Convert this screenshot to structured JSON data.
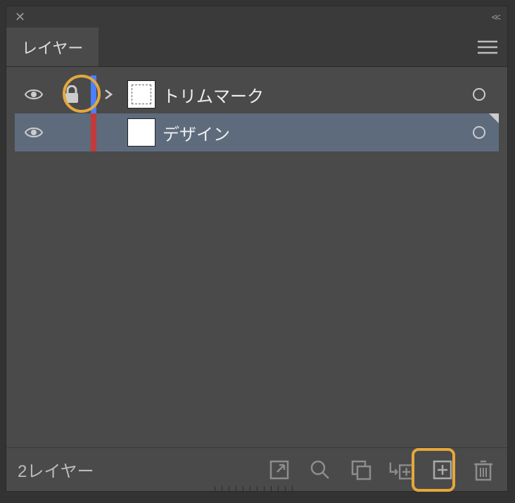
{
  "panel": {
    "tab_title": "レイヤー",
    "layers": [
      {
        "name": "トリムマーク",
        "visible": true,
        "locked": true,
        "expandable": true,
        "color": "blue",
        "thumb": "trim",
        "selected": false
      },
      {
        "name": "デザイン",
        "visible": true,
        "locked": false,
        "expandable": false,
        "color": "red",
        "thumb": "blank",
        "selected": true
      }
    ],
    "footer_count": "2レイヤー"
  },
  "highlight_color": "#e5a83b"
}
